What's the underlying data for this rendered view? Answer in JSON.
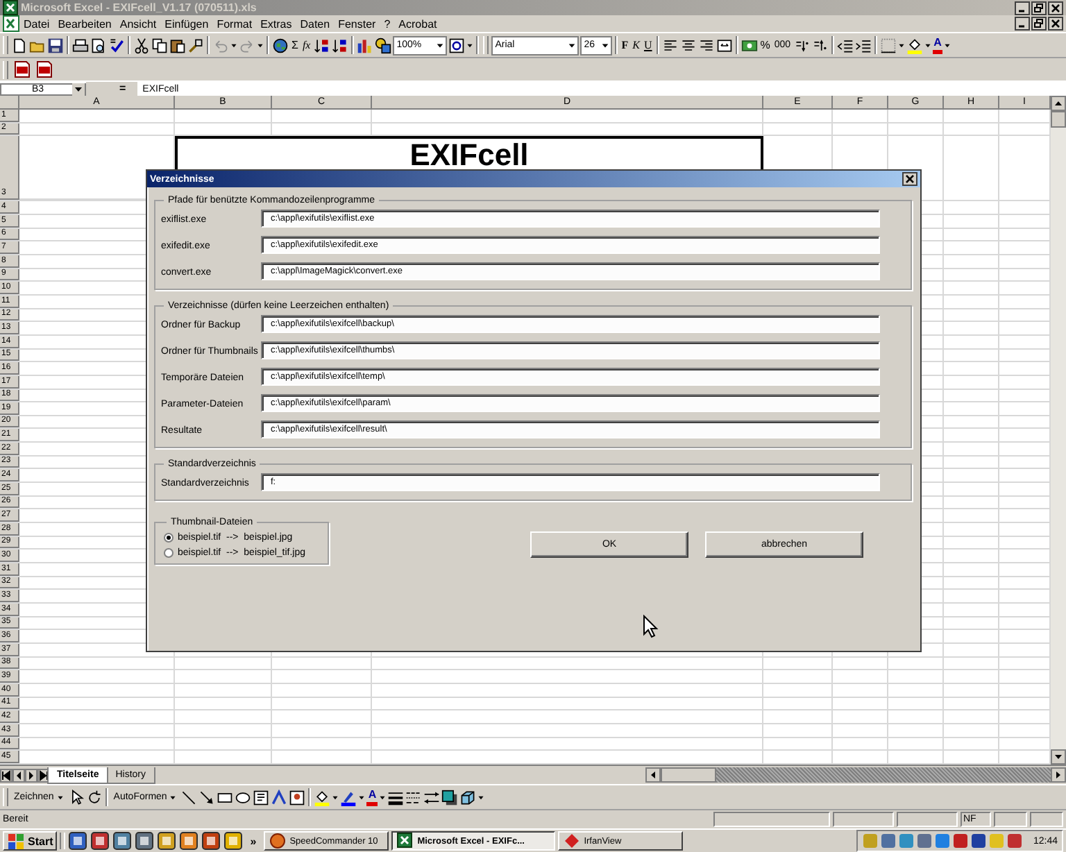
{
  "window": {
    "title": "Microsoft Excel - EXIFcell_V1.17 (070511).xls"
  },
  "menu": [
    "Datei",
    "Bearbeiten",
    "Ansicht",
    "Einfügen",
    "Format",
    "Extras",
    "Daten",
    "Fenster",
    "?",
    "Acrobat"
  ],
  "toolbar": {
    "sum": "Σ",
    "function": "fx",
    "zoom": "100%",
    "font": "Arial",
    "size": "26",
    "styles": [
      "F",
      "K",
      "U"
    ],
    "percent": "%",
    "thousands": "000",
    "font_color": "A"
  },
  "formula_bar": {
    "cell_ref": "B3",
    "equals": "=",
    "value": "EXIFcell"
  },
  "columns": [
    "A",
    "B",
    "C",
    "D",
    "E",
    "F",
    "G",
    "H",
    "I"
  ],
  "rows": [
    {
      "label": "1"
    },
    {
      "label": "2"
    },
    {
      "label": "3",
      "cell": "EXIFcell"
    },
    {
      "label": "4"
    },
    {
      "label": "5"
    },
    {
      "label": "6"
    },
    {
      "label": "7"
    },
    {
      "label": "8"
    },
    {
      "label": "9"
    },
    {
      "label": "10"
    },
    {
      "label": "11"
    },
    {
      "label": "12"
    },
    {
      "label": "13"
    },
    {
      "label": "14"
    },
    {
      "label": "15"
    },
    {
      "label": "16"
    },
    {
      "label": "17"
    },
    {
      "label": "18"
    },
    {
      "label": "19"
    },
    {
      "label": "20"
    },
    {
      "label": "21"
    },
    {
      "label": "22"
    },
    {
      "label": "23"
    },
    {
      "label": "24"
    },
    {
      "label": "25"
    },
    {
      "label": "26"
    },
    {
      "label": "27"
    },
    {
      "label": "28"
    },
    {
      "label": "29"
    },
    {
      "label": "30"
    },
    {
      "label": "31"
    },
    {
      "label": "32"
    },
    {
      "label": "33"
    },
    {
      "label": "34"
    },
    {
      "label": "35"
    },
    {
      "label": "36"
    },
    {
      "label": "37"
    },
    {
      "label": "38"
    },
    {
      "label": "39"
    },
    {
      "label": "40"
    },
    {
      "label": "41"
    },
    {
      "label": "42"
    },
    {
      "label": "43"
    },
    {
      "label": "44"
    },
    {
      "label": "45"
    }
  ],
  "dialog": {
    "title": "Verzeichnisse",
    "groups": [
      {
        "title": "Pfade für benützte Kommandozeilenprogramme",
        "fields": [
          {
            "label": "exiflist.exe",
            "value": "c:\\appl\\exifutils\\exiflist.exe"
          },
          {
            "label": "exifedit.exe",
            "value": "c:\\appl\\exifutils\\exifedit.exe"
          },
          {
            "label": "convert.exe",
            "value": "c:\\appl\\ImageMagick\\convert.exe"
          }
        ]
      },
      {
        "title": "Verzeichnisse  (dürfen keine Leerzeichen enthalten)",
        "fields": [
          {
            "label": "Ordner für Backup",
            "value": "c:\\appl\\exifutils\\exifcell\\backup\\"
          },
          {
            "label": "Ordner für Thumbnails",
            "value": "c:\\appl\\exifutils\\exifcell\\thumbs\\"
          },
          {
            "label": "Temporäre Dateien",
            "value": "c:\\appl\\exifutils\\exifcell\\temp\\"
          },
          {
            "label": "Parameter-Dateien",
            "value": "c:\\appl\\exifutils\\exifcell\\param\\"
          },
          {
            "label": "Resultate",
            "value": "c:\\appl\\exifutils\\exifcell\\result\\"
          }
        ]
      },
      {
        "title": "Standardverzeichnis",
        "fields": [
          {
            "label": "Standardverzeichnis",
            "value": "f:"
          }
        ]
      }
    ],
    "thumbnail": {
      "title": "Thumbnail-Dateien",
      "options": [
        {
          "label": "beispiel.tif  -->  beispiel.jpg",
          "selected": true
        },
        {
          "label": "beispiel.tif  -->  beispiel_tif.jpg",
          "selected": false
        }
      ]
    },
    "buttons": [
      "OK",
      "abbrechen"
    ]
  },
  "sheet_tabs": [
    {
      "label": "Titelseite",
      "selected": true
    },
    {
      "label": "History",
      "selected": false
    }
  ],
  "drawing_toolbar": {
    "draw_menu": "Zeichnen",
    "autoshapes": "AutoFormen",
    "font_color": "A"
  },
  "status_bar": {
    "text": "Bereit",
    "indicator": "NF"
  },
  "taskbar": {
    "start": "Start",
    "more": "»",
    "tasks": [
      {
        "label": "SpeedCommander 10",
        "selected": false
      },
      {
        "label": "Microsoft Excel - EXIFc...",
        "selected": true
      },
      {
        "label": "IrfanView",
        "selected": false
      }
    ],
    "clock": "12:44"
  }
}
